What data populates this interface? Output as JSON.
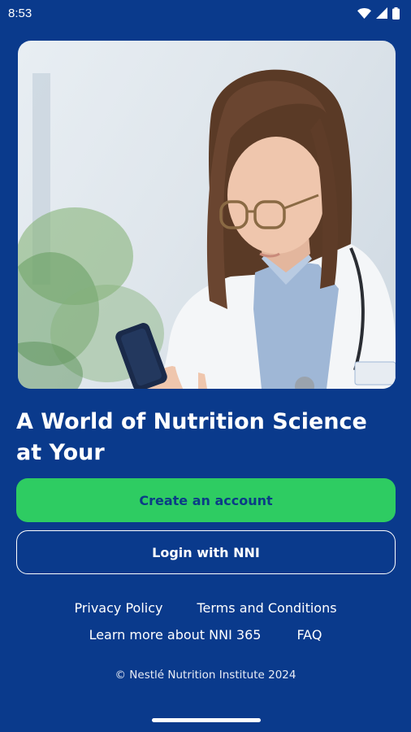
{
  "status_bar": {
    "time": "8:53",
    "icons": [
      "wifi-icon",
      "signal-icon",
      "battery-icon"
    ]
  },
  "hero": {
    "image_subject": "woman in white coat and glasses looking at a phone"
  },
  "headline": "A World of Nutrition Science at Your",
  "buttons": {
    "create_account": "Create an account",
    "login": "Login with NNI"
  },
  "links": {
    "privacy": "Privacy Policy",
    "terms": "Terms and Conditions",
    "learn_more": "Learn more about NNI 365",
    "faq": "FAQ"
  },
  "footer": "© Nestlé Nutrition Institute 2024",
  "colors": {
    "background": "#0a3a8c",
    "accent_green": "#2ecc62",
    "text": "#ffffff"
  }
}
